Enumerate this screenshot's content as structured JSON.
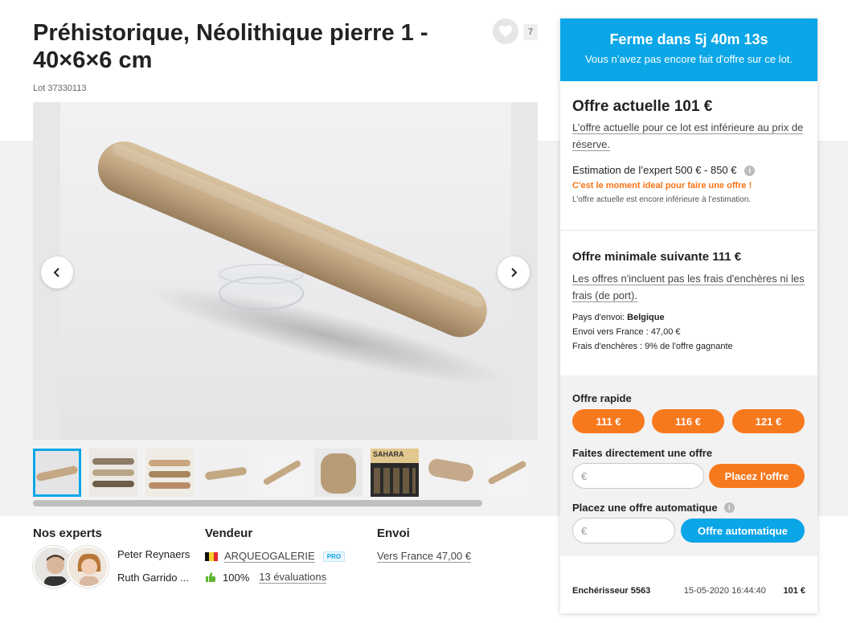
{
  "lot": {
    "title": "Préhistorique, Néolithique pierre 1 - 40×6×6 cm",
    "lot_number": "Lot 37330113",
    "favorite_count": "7"
  },
  "viewer": {
    "prev_icon": "chevron-left-icon",
    "next_icon": "chevron-right-icon",
    "thumbnail_count": 9,
    "scroll_fraction": 0.89
  },
  "thumbs": {
    "sahara_label": "SAHARA"
  },
  "experts": {
    "heading": "Nos experts",
    "names": [
      "Peter Reynaers",
      "Ruth Garrido ..."
    ]
  },
  "seller": {
    "heading": "Vendeur",
    "name": "ARQUEOGALERIE",
    "badge": "PRO",
    "rating": "100%",
    "reviews": "13 évaluations"
  },
  "shipping": {
    "heading": "Envoi",
    "to": "Vers France 47,00 €"
  },
  "panel": {
    "timer": "Ferme dans 5j 40m 13s",
    "timer_sub": "Vous n’avez pas encore fait d'offre sur ce lot.",
    "current_bid": "Offre actuelle 101 €",
    "reserve_note": "L’offre actuelle pour ce lot est inférieure au prix de réserve.",
    "estimate": "Estimation de l’expert 500 € - 850 €",
    "moment": "C'est le moment ideal pour faire une offre !",
    "below_estimate": "L’offre actuelle est encore inférieure à l’estimation.",
    "min_next": "Offre minimale suivante 111 €",
    "fees_note": "Les offres n'incluent pas les frais d'enchères ni les frais (de port).",
    "country_label": "Pays d'envoi:",
    "country": "Belgique",
    "ship_france": "Envoi vers France : 47,00 €",
    "auction_fees": "Frais d'enchères : 9% de l'offre gagnante",
    "quick_label": "Offre rapide",
    "quick_bids": [
      "111 €",
      "116 €",
      "121 €"
    ],
    "direct_label": "Faites directement une offre",
    "currency": "€",
    "place_bid": "Placez l'offre",
    "auto_label": "Placez une offre automatique",
    "auto_btn": "Offre automatique",
    "history": {
      "bidder": "Enchérisseur 5563",
      "date": "15-05-2020 16:44:40",
      "amount": "101 €"
    }
  },
  "colors": {
    "accent_blue": "#0aa6e7",
    "accent_orange": "#f7791e",
    "warn_orange": "#f97316"
  }
}
